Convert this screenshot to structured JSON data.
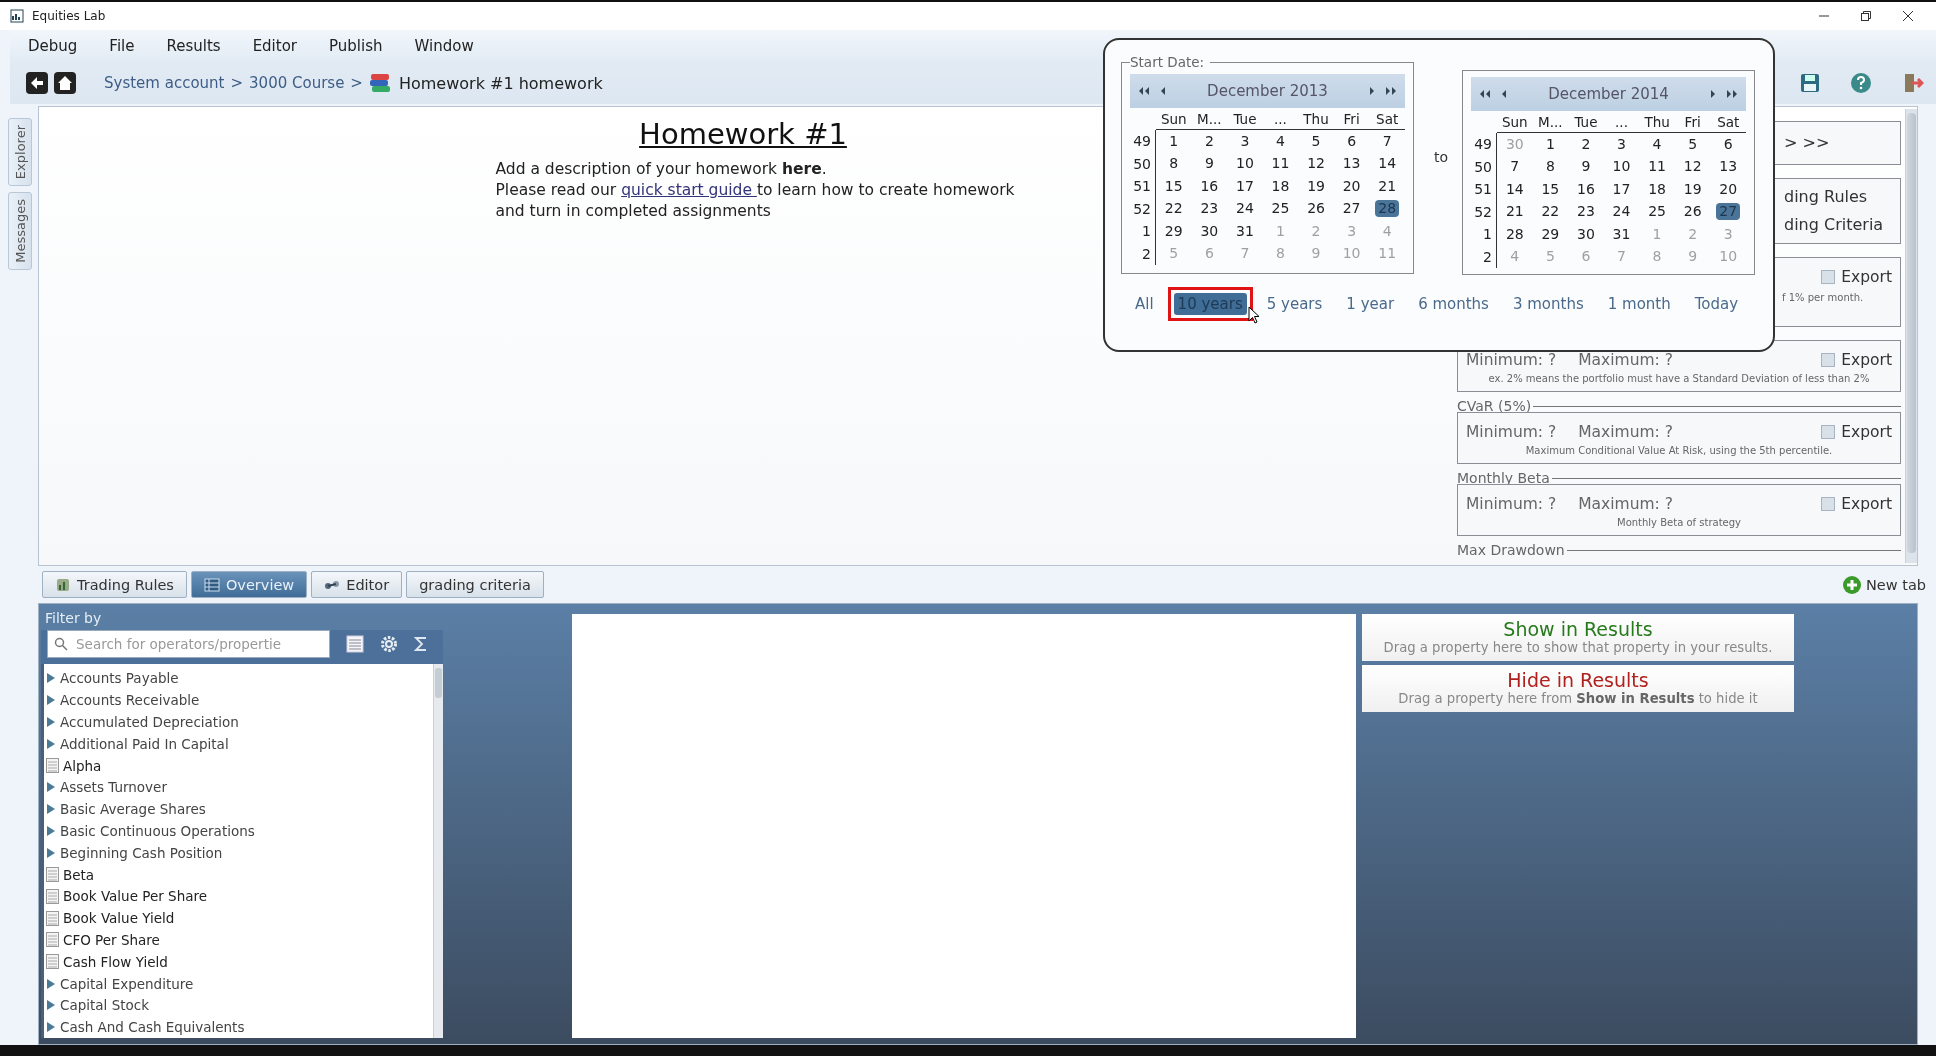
{
  "window": {
    "title": "Equities Lab"
  },
  "menu": [
    "Debug",
    "File",
    "Results",
    "Editor",
    "Publish",
    "Window"
  ],
  "breadcrumb": {
    "crumbs": [
      "System account",
      "3000 Course"
    ],
    "separator": ">",
    "current": "Homework #1 homework"
  },
  "side_tabs": [
    "Explorer",
    "Messages"
  ],
  "homework": {
    "title": "Homework #1",
    "line1": "Add a description of your homework **here**.",
    "before_link": "Please read our ",
    "link": "quick start guide ",
    "after_link": "to learn how to create homework and turn in completed assignments"
  },
  "criteria_boxes": [
    {
      "kind": "fragment",
      "lines": [
        "> >>"
      ]
    },
    {
      "kind": "fragment",
      "lines": [
        "ding Rules",
        "ding Criteria"
      ]
    },
    {
      "kind": "partial",
      "export": "Export",
      "checked": false,
      "note": "f 1% per month."
    },
    {
      "kind": "range",
      "minimum": "Minimum:  ?",
      "maximum": "Maximum:  ?",
      "export": "Export",
      "checked": false,
      "note": "ex. 2% means the portfolio must have a Standard Deviation of less than 2%"
    },
    {
      "kind": "range",
      "title": "CVaR (5%)",
      "minimum": "Minimum:  ?",
      "maximum": "Maximum:  ?",
      "export": "Export",
      "checked": false,
      "note": "Maximum Conditional Value At Risk, using the 5th percentile."
    },
    {
      "kind": "range",
      "title": "Monthly Beta",
      "minimum": "Minimum: ?",
      "maximum": "Maximum: ?",
      "export": "Export",
      "checked": false,
      "note": "Monthly Beta of strategy"
    },
    {
      "kind": "heading",
      "title": "Max Drawdown"
    }
  ],
  "tabs": [
    {
      "label": "Trading Rules",
      "selected": false
    },
    {
      "label": "Overview",
      "selected": true
    },
    {
      "label": "Editor",
      "selected": false
    },
    {
      "label": "grading criteria",
      "selected": false
    }
  ],
  "new_tab": "New tab",
  "filter": {
    "title": "Filter by",
    "placeholder": "Search for operators/propertie",
    "items": [
      {
        "label": "Accounts Payable",
        "kind": "group"
      },
      {
        "label": "Accounts Receivable",
        "kind": "group"
      },
      {
        "label": "Accumulated Depreciation",
        "kind": "group"
      },
      {
        "label": "Additional Paid In Capital",
        "kind": "group"
      },
      {
        "label": "Alpha",
        "kind": "field"
      },
      {
        "label": "Assets Turnover",
        "kind": "group"
      },
      {
        "label": "Basic Average Shares",
        "kind": "group"
      },
      {
        "label": "Basic Continuous Operations",
        "kind": "group"
      },
      {
        "label": "Beginning Cash Position",
        "kind": "group"
      },
      {
        "label": "Beta",
        "kind": "field"
      },
      {
        "label": "Book Value Per Share",
        "kind": "field"
      },
      {
        "label": "Book Value Yield",
        "kind": "field"
      },
      {
        "label": "CFO Per Share",
        "kind": "field"
      },
      {
        "label": "Cash Flow Yield",
        "kind": "field"
      },
      {
        "label": "Capital Expenditure",
        "kind": "group"
      },
      {
        "label": "Capital Stock",
        "kind": "group"
      },
      {
        "label": "Cash And Cash Equivalents",
        "kind": "group"
      }
    ]
  },
  "result_zones": [
    {
      "title": "Show in Results",
      "hint": "Drag a property here to show that property in your results.",
      "color": "#267a1c"
    },
    {
      "title": "Hide in Results",
      "hint": "Drag a property here from **Show in Results** to hide it",
      "color": "#b0201c"
    }
  ],
  "date_picker": {
    "start_label": "Start Date:",
    "to": "to",
    "calendars": [
      {
        "month": "December 2013",
        "weekdays": [
          "Sun",
          "M...",
          "Tue",
          "...",
          "Thu",
          "Fri",
          "Sat"
        ],
        "weeks": [
          {
            "week": "49",
            "days": [
              {
                "day": "1",
                "outside": false,
                "selected": false
              },
              {
                "day": "2",
                "outside": false,
                "selected": false
              },
              {
                "day": "3",
                "outside": false,
                "selected": false
              },
              {
                "day": "4",
                "outside": false,
                "selected": false
              },
              {
                "day": "5",
                "outside": false,
                "selected": false
              },
              {
                "day": "6",
                "outside": false,
                "selected": false
              },
              {
                "day": "7",
                "outside": false,
                "selected": false
              }
            ]
          },
          {
            "week": "50",
            "days": [
              {
                "day": "8",
                "outside": false,
                "selected": false
              },
              {
                "day": "9",
                "outside": false,
                "selected": false
              },
              {
                "day": "10",
                "outside": false,
                "selected": false
              },
              {
                "day": "11",
                "outside": false,
                "selected": false
              },
              {
                "day": "12",
                "outside": false,
                "selected": false
              },
              {
                "day": "13",
                "outside": false,
                "selected": false
              },
              {
                "day": "14",
                "outside": false,
                "selected": false
              }
            ]
          },
          {
            "week": "51",
            "days": [
              {
                "day": "15",
                "outside": false,
                "selected": false
              },
              {
                "day": "16",
                "outside": false,
                "selected": false
              },
              {
                "day": "17",
                "outside": false,
                "selected": false
              },
              {
                "day": "18",
                "outside": false,
                "selected": false
              },
              {
                "day": "19",
                "outside": false,
                "selected": false
              },
              {
                "day": "20",
                "outside": false,
                "selected": false
              },
              {
                "day": "21",
                "outside": false,
                "selected": false
              }
            ]
          },
          {
            "week": "52",
            "days": [
              {
                "day": "22",
                "outside": false,
                "selected": false
              },
              {
                "day": "23",
                "outside": false,
                "selected": false
              },
              {
                "day": "24",
                "outside": false,
                "selected": false
              },
              {
                "day": "25",
                "outside": false,
                "selected": false
              },
              {
                "day": "26",
                "outside": false,
                "selected": false
              },
              {
                "day": "27",
                "outside": false,
                "selected": false
              },
              {
                "day": "28",
                "outside": false,
                "selected": true
              }
            ]
          },
          {
            "week": "1",
            "days": [
              {
                "day": "29",
                "outside": false,
                "selected": false
              },
              {
                "day": "30",
                "outside": false,
                "selected": false
              },
              {
                "day": "31",
                "outside": false,
                "selected": false
              },
              {
                "day": "1",
                "outside": true,
                "selected": false
              },
              {
                "day": "2",
                "outside": true,
                "selected": false
              },
              {
                "day": "3",
                "outside": true,
                "selected": false
              },
              {
                "day": "4",
                "outside": true,
                "selected": false
              }
            ]
          },
          {
            "week": "2",
            "days": [
              {
                "day": "5",
                "outside": true,
                "selected": false
              },
              {
                "day": "6",
                "outside": true,
                "selected": false
              },
              {
                "day": "7",
                "outside": true,
                "selected": false
              },
              {
                "day": "8",
                "outside": true,
                "selected": false
              },
              {
                "day": "9",
                "outside": true,
                "selected": false
              },
              {
                "day": "10",
                "outside": true,
                "selected": false
              },
              {
                "day": "11",
                "outside": true,
                "selected": false
              }
            ]
          }
        ]
      },
      {
        "month": "December 2014",
        "weekdays": [
          "Sun",
          "M...",
          "Tue",
          "...",
          "Thu",
          "Fri",
          "Sat"
        ],
        "weeks": [
          {
            "week": "49",
            "days": [
              {
                "day": "30",
                "outside": true,
                "selected": false
              },
              {
                "day": "1",
                "outside": false,
                "selected": false
              },
              {
                "day": "2",
                "outside": false,
                "selected": false
              },
              {
                "day": "3",
                "outside": false,
                "selected": false
              },
              {
                "day": "4",
                "outside": false,
                "selected": false
              },
              {
                "day": "5",
                "outside": false,
                "selected": false
              },
              {
                "day": "6",
                "outside": false,
                "selected": false
              }
            ]
          },
          {
            "week": "50",
            "days": [
              {
                "day": "7",
                "outside": false,
                "selected": false
              },
              {
                "day": "8",
                "outside": false,
                "selected": false
              },
              {
                "day": "9",
                "outside": false,
                "selected": false
              },
              {
                "day": "10",
                "outside": false,
                "selected": false
              },
              {
                "day": "11",
                "outside": false,
                "selected": false
              },
              {
                "day": "12",
                "outside": false,
                "selected": false
              },
              {
                "day": "13",
                "outside": false,
                "selected": false
              }
            ]
          },
          {
            "week": "51",
            "days": [
              {
                "day": "14",
                "outside": false,
                "selected": false
              },
              {
                "day": "15",
                "outside": false,
                "selected": false
              },
              {
                "day": "16",
                "outside": false,
                "selected": false
              },
              {
                "day": "17",
                "outside": false,
                "selected": false
              },
              {
                "day": "18",
                "outside": false,
                "selected": false
              },
              {
                "day": "19",
                "outside": false,
                "selected": false
              },
              {
                "day": "20",
                "outside": false,
                "selected": false
              }
            ]
          },
          {
            "week": "52",
            "days": [
              {
                "day": "21",
                "outside": false,
                "selected": false
              },
              {
                "day": "22",
                "outside": false,
                "selected": false
              },
              {
                "day": "23",
                "outside": false,
                "selected": false
              },
              {
                "day": "24",
                "outside": false,
                "selected": false
              },
              {
                "day": "25",
                "outside": false,
                "selected": false
              },
              {
                "day": "26",
                "outside": false,
                "selected": false
              },
              {
                "day": "27",
                "outside": false,
                "selected": true
              }
            ]
          },
          {
            "week": "1",
            "days": [
              {
                "day": "28",
                "outside": false,
                "selected": false
              },
              {
                "day": "29",
                "outside": false,
                "selected": false
              },
              {
                "day": "30",
                "outside": false,
                "selected": false
              },
              {
                "day": "31",
                "outside": false,
                "selected": false
              },
              {
                "day": "1",
                "outside": true,
                "selected": false
              },
              {
                "day": "2",
                "outside": true,
                "selected": false
              },
              {
                "day": "3",
                "outside": true,
                "selected": false
              }
            ]
          },
          {
            "week": "2",
            "days": [
              {
                "day": "4",
                "outside": true,
                "selected": false
              },
              {
                "day": "5",
                "outside": true,
                "selected": false
              },
              {
                "day": "6",
                "outside": true,
                "selected": false
              },
              {
                "day": "7",
                "outside": true,
                "selected": false
              },
              {
                "day": "8",
                "outside": true,
                "selected": false
              },
              {
                "day": "9",
                "outside": true,
                "selected": false
              },
              {
                "day": "10",
                "outside": true,
                "selected": false
              }
            ]
          }
        ]
      }
    ],
    "ranges": [
      {
        "label": "All",
        "selected": false,
        "highlighted": false
      },
      {
        "label": "10 years",
        "selected": true,
        "highlighted": true
      },
      {
        "label": "5 years",
        "selected": false,
        "highlighted": false
      },
      {
        "label": "1 year",
        "selected": false,
        "highlighted": false
      },
      {
        "label": "6 months",
        "selected": false,
        "highlighted": false
      },
      {
        "label": "3 months",
        "selected": false,
        "highlighted": false
      },
      {
        "label": "1 month",
        "selected": false,
        "highlighted": false
      },
      {
        "label": "Today",
        "selected": false,
        "highlighted": false
      }
    ]
  }
}
